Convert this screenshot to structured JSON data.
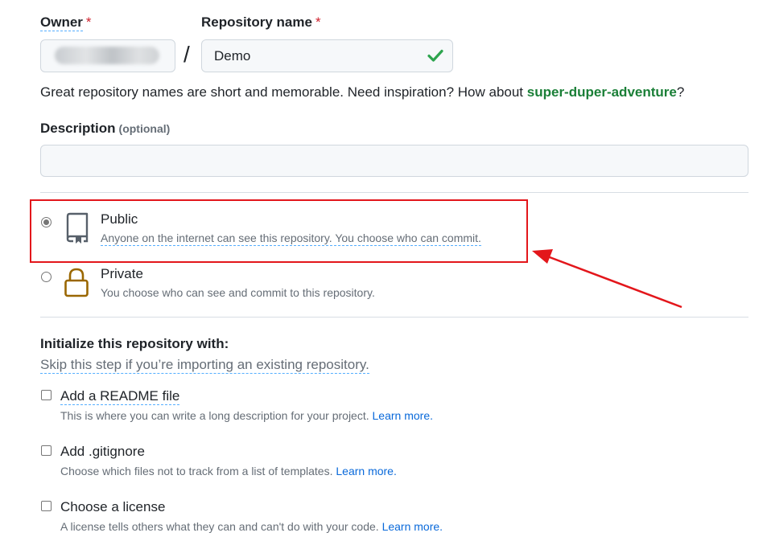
{
  "owner": {
    "label": "Owner",
    "required_mark": "*"
  },
  "repo": {
    "label": "Repository name",
    "required_mark": "*",
    "value": "Demo",
    "separator": "/"
  },
  "hint": {
    "prefix": "Great repository names are short and memorable. Need inspiration? How about ",
    "suggestion": "super-duper-adventure",
    "suffix": "?"
  },
  "description": {
    "label": "Description",
    "optional": "(optional)",
    "value": ""
  },
  "visibility": {
    "public": {
      "title": "Public",
      "desc": "Anyone on the internet can see this repository. You choose who can commit.",
      "selected": true
    },
    "private": {
      "title": "Private",
      "desc": "You choose who can see and commit to this repository.",
      "selected": false
    }
  },
  "init": {
    "title": "Initialize this repository with:",
    "subtitle": "Skip this step if you’re importing an existing repository.",
    "options": [
      {
        "title": "Add a README file",
        "desc": "This is where you can write a long description for your project.",
        "link": "Learn more."
      },
      {
        "title": "Add .gitignore",
        "desc": "Choose which files not to track from a list of templates.",
        "link": "Learn more."
      },
      {
        "title": "Choose a license",
        "desc": "A license tells others what they can and can't do with your code.",
        "link": "Learn more."
      }
    ]
  },
  "colors": {
    "accent_red": "#e3161b",
    "success_green": "#1a7f37",
    "link_blue": "#0969da",
    "lock_gold": "#9a6700"
  }
}
